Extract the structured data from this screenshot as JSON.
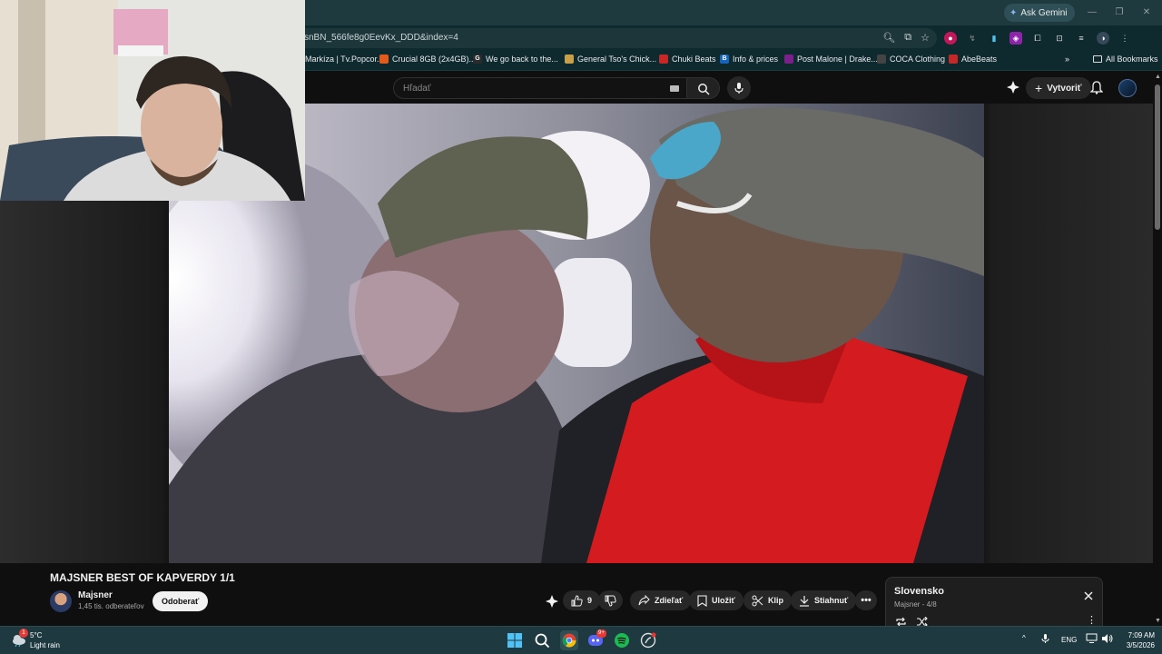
{
  "browser": {
    "ask_gemini": "Ask Gemini",
    "url": "ysnBN_566fe8g0EevKx_DDD&index=4",
    "bookmarks": [
      {
        "label": "Markíza | Tv.Popcor...",
        "color": "#3b4a9a"
      },
      {
        "label": "Crucial 8GB (2x4GB)...",
        "color": "#e25a1c"
      },
      {
        "label": "We go back to the...",
        "color": "#4285f4",
        "glyph": "G"
      },
      {
        "label": "General Tso's Chick...",
        "color": "#c8a04a"
      },
      {
        "label": "Chuki Beats",
        "color": "#c62828"
      },
      {
        "label": "Info & prices",
        "color": "#1565c0",
        "glyph": "B."
      },
      {
        "label": "Post Malone | Drake...",
        "color": "#7b1f8a"
      },
      {
        "label": "COCA Clothing",
        "color": "#222222"
      },
      {
        "label": "AbeBeats",
        "color": "#c62828"
      }
    ],
    "all_bookmarks": "All Bookmarks"
  },
  "youtube": {
    "search_placeholder": "Hľadať",
    "create_label": "Vytvoriť"
  },
  "video": {
    "title": "MAJSNER BEST OF KAPVERDY 1/1",
    "channel": "Majsner",
    "subscribers": "1,45 tis. odberateľov",
    "subscribe_label": "Odoberať",
    "likes": "9",
    "share_label": "Zdieľať",
    "save_label": "Uložiť",
    "clip_label": "Klip",
    "download_label": "Stiahnuť"
  },
  "playlist": {
    "title": "Slovensko",
    "subtitle": "Majsner - 4/8"
  },
  "taskbar": {
    "temperature": "5°C",
    "weather": "Light rain",
    "language": "ENG",
    "time": "7:09 AM",
    "date": "3/5/2026",
    "notification_badge": "1",
    "discord_badge": "9+"
  }
}
